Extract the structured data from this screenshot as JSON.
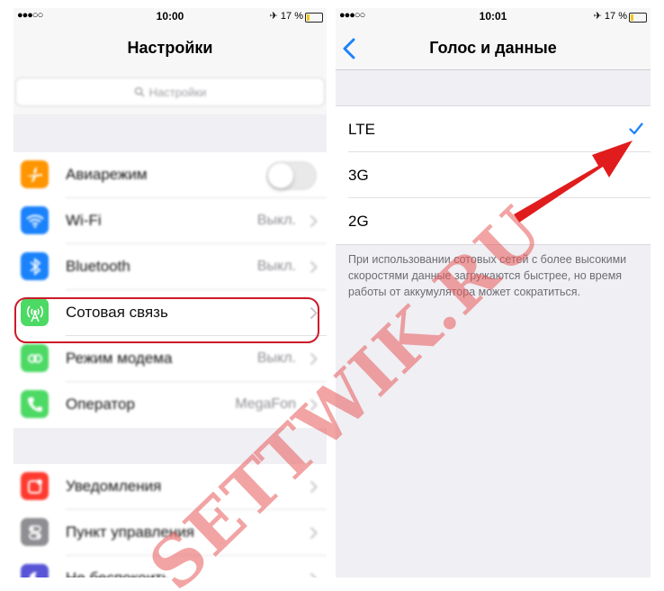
{
  "left_screen": {
    "status_bar": {
      "signal": "●●●○○",
      "time": "10:00",
      "right": "✈ 17 %"
    },
    "title": "Настройки",
    "search": {
      "placeholder": "Настройки"
    },
    "group1": [
      {
        "label": "Авиарежим",
        "value": "",
        "icon": "airplane-icon",
        "color": "#ff9500",
        "toggle": true
      },
      {
        "label": "Wi-Fi",
        "value": "Выкл.",
        "icon": "wifi-icon",
        "color": "#1a82fb"
      },
      {
        "label": "Bluetooth",
        "value": "Выкл.",
        "icon": "bluetooth-icon",
        "color": "#1a82fb"
      },
      {
        "label": "Сотовая связь",
        "value": "",
        "icon": "cellular-antenna-icon",
        "color": "#4cd964",
        "highlighted": true
      },
      {
        "label": "Режим модема",
        "value": "Выкл.",
        "icon": "hotspot-icon",
        "color": "#4cd964"
      },
      {
        "label": "Оператор",
        "value": "MegaFon",
        "icon": "phone-icon",
        "color": "#4cd964"
      }
    ],
    "group2": [
      {
        "label": "Уведомления",
        "icon": "notifications-icon",
        "color": "#ff3b30"
      },
      {
        "label": "Пункт управления",
        "icon": "control-center-icon",
        "color": "#8e8e93"
      },
      {
        "label": "Не беспокоить",
        "icon": "moon-icon",
        "color": "#5856d6"
      }
    ],
    "highlight_color": "#cc1a27"
  },
  "right_screen": {
    "status_bar": {
      "signal": "●●●○○",
      "time": "10:01",
      "right": "✈ 17 %"
    },
    "title": "Голос и данные",
    "options": [
      {
        "label": "LTE",
        "checked": true
      },
      {
        "label": "3G",
        "checked": false
      },
      {
        "label": "2G",
        "checked": false
      }
    ],
    "footnote": "При использовании сотовых сетей с более высокими скоростями данные загружаются быстрее, но время работы от аккумулятора может сократиться.",
    "accent": "#1a82fb"
  },
  "watermark": {
    "text": "SETTWIK.RU",
    "color": "#e85a5a"
  },
  "arrow_color": "#e01c1c"
}
